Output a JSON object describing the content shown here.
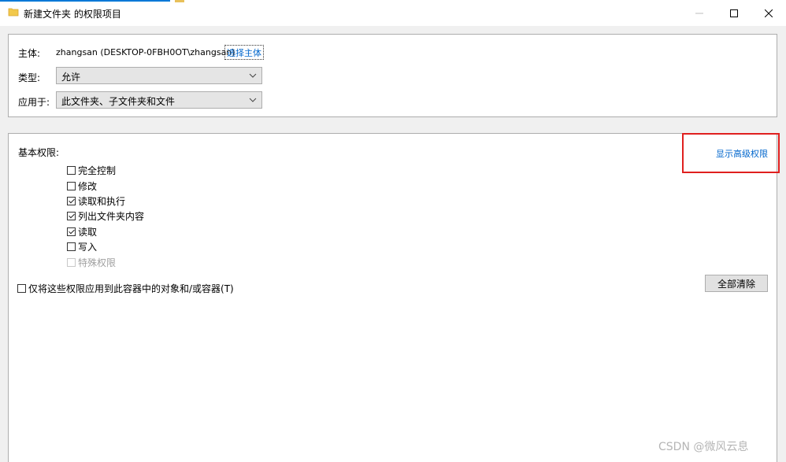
{
  "window": {
    "title": "新建文件夹 的权限项目",
    "icons": {
      "folder": "folder-icon",
      "minimize": "minimize-icon",
      "maximize": "maximize-icon",
      "close": "close-icon"
    }
  },
  "principal": {
    "label": "主体:",
    "value": "zhangsan (DESKTOP-0FBH0OT\\zhangsan)",
    "select_link": "选择主体"
  },
  "type": {
    "label": "类型:",
    "value": "允许"
  },
  "applies_to": {
    "label": "应用于:",
    "value": "此文件夹、子文件夹和文件"
  },
  "permissions": {
    "heading": "基本权限:",
    "advanced_link": "显示高级权限",
    "items": [
      {
        "label": "完全控制",
        "checked": false,
        "enabled": true
      },
      {
        "label": "修改",
        "checked": false,
        "enabled": true
      },
      {
        "label": "读取和执行",
        "checked": true,
        "enabled": true
      },
      {
        "label": "列出文件夹内容",
        "checked": true,
        "enabled": true
      },
      {
        "label": "读取",
        "checked": true,
        "enabled": true
      },
      {
        "label": "写入",
        "checked": false,
        "enabled": true
      },
      {
        "label": "特殊权限",
        "checked": false,
        "enabled": false
      }
    ],
    "apply_only_label": "仅将这些权限应用到此容器中的对象和/或容器(T)",
    "clear_all_button": "全部清除"
  },
  "watermark": "CSDN @微风云息",
  "colors": {
    "link": "#0066cc",
    "highlight": "#e0201f",
    "accent": "#0078d7"
  }
}
